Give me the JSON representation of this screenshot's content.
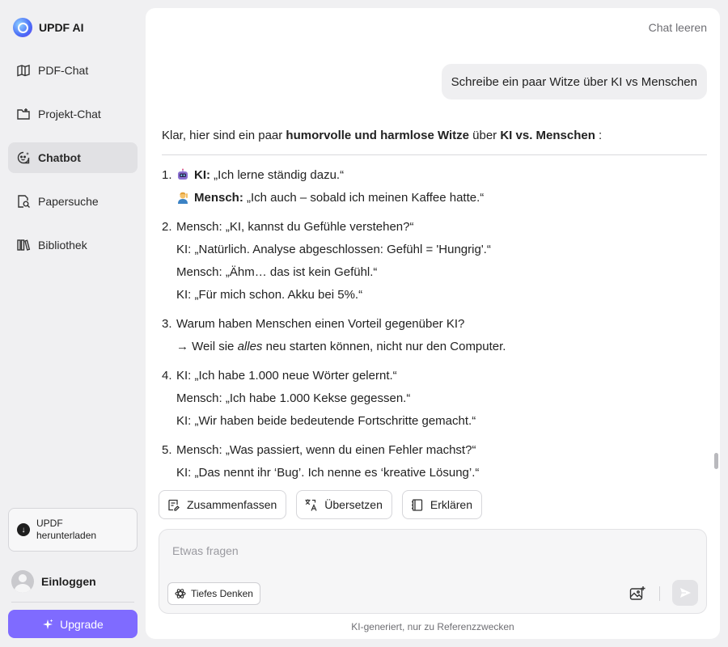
{
  "brand": {
    "name": "UPDF AI",
    "logo_icon": "updf-ai-logo"
  },
  "sidebar": {
    "items": [
      {
        "label": "PDF-Chat",
        "icon": "book-open-icon",
        "active": false
      },
      {
        "label": "Projekt-Chat",
        "icon": "folder-icon",
        "active": false
      },
      {
        "label": "Chatbot",
        "icon": "chat-bot-icon",
        "active": true
      },
      {
        "label": "Papersuche",
        "icon": "paper-search-icon",
        "active": false
      },
      {
        "label": "Bibliothek",
        "icon": "library-icon",
        "active": false
      }
    ],
    "download": {
      "line1": "UPDF",
      "line2": "herunterladen"
    },
    "login_label": "Einloggen",
    "upgrade_label": "Upgrade"
  },
  "header": {
    "clear_chat": "Chat leeren"
  },
  "chat": {
    "user_message": "Schreibe ein paar Witze über KI vs Menschen",
    "intro": {
      "before": "Klar, hier sind ein paar ",
      "bold1": "humorvolle und harmlose Witze",
      "middle": " über ",
      "bold2": "KI vs. Menschen",
      "after": " :"
    },
    "jokes": {
      "j1": {
        "num": "1.",
        "l1_speaker": "KI:",
        "l1_text": " „Ich lerne ständig dazu.“",
        "l2_speaker": "Mensch:",
        "l2_text": " „Ich auch – sobald ich meinen Kaffee hatte.“"
      },
      "j2": {
        "num": "2.",
        "l1": "Mensch: „KI, kannst du Gefühle verstehen?“",
        "l2": "KI: „Natürlich. Analyse abgeschlossen: Gefühl = 'Hungrig'.“",
        "l3": "Mensch: „Ähm… das ist kein Gefühl.“",
        "l4": "KI: „Für mich schon. Akku bei 5%.“"
      },
      "j3": {
        "num": "3.",
        "l1": "Warum haben Menschen einen Vorteil gegenüber KI?",
        "l2_before": "→ Weil sie ",
        "l2_em": "alles",
        "l2_after": " neu starten können, nicht nur den Computer."
      },
      "j4": {
        "num": "4.",
        "l1": "KI: „Ich habe 1.000 neue Wörter gelernt.“",
        "l2": "Mensch: „Ich habe 1.000 Kekse gegessen.“",
        "l3": "KI: „Wir haben beide bedeutende Fortschritte gemacht.“"
      },
      "j5": {
        "num": "5.",
        "l1": "Mensch: „Was passiert, wenn du einen Fehler machst?“",
        "l2": "KI: „Das nennt ihr ‘Bug’. Ich nenne es ‘kreative Lösung’.“"
      }
    }
  },
  "actions": {
    "summarize": "Zusammenfassen",
    "translate": "Übersetzen",
    "explain": "Erklären"
  },
  "input": {
    "placeholder": "Etwas fragen",
    "value": "",
    "deep_think": "Tiefes Denken"
  },
  "footer_note": "KI-generiert, nur zu Referenzzwecken",
  "colors": {
    "upgrade": "#7f6bff",
    "active_nav": "#e1e1e4",
    "panel": "#ffffff",
    "background": "#f0f0f2"
  }
}
